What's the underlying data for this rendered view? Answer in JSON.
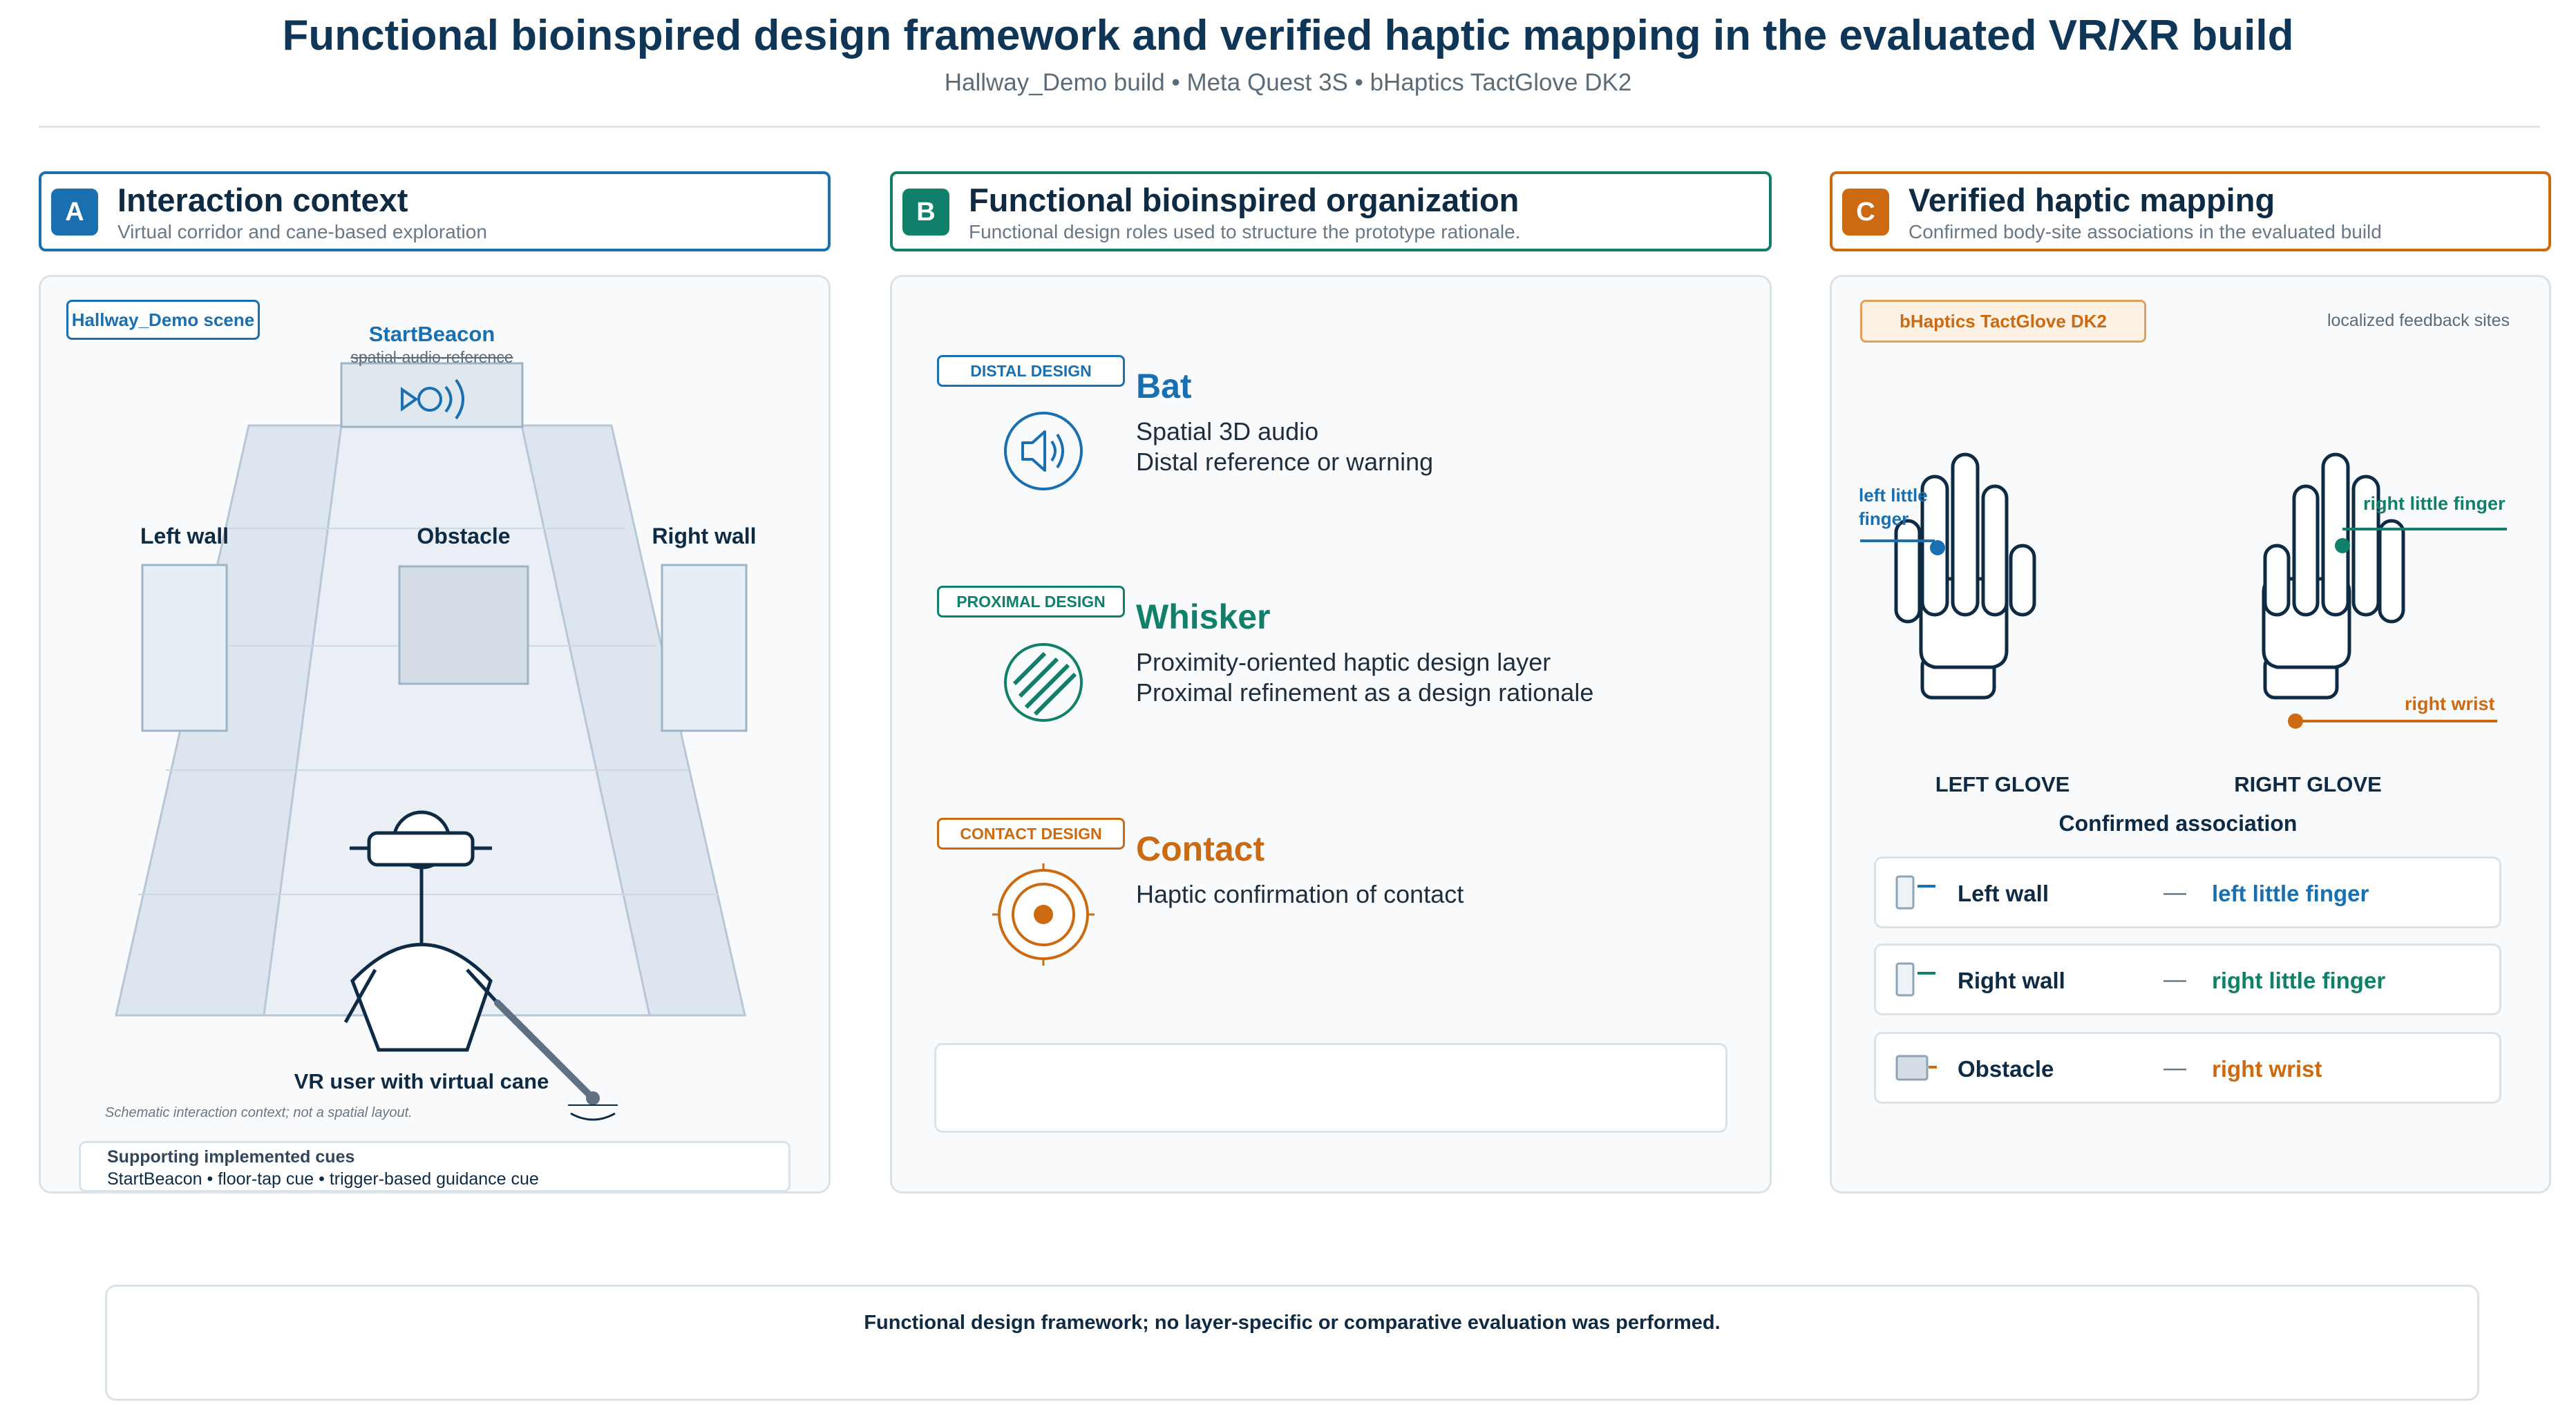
{
  "header": {
    "title": "Functional bioinspired design framework and verified haptic mapping in the evaluated VR/XR build",
    "subtitle": "Hallway_Demo build • Meta Quest 3S • bHaptics TactGlove DK2"
  },
  "colors": {
    "blue": "#1a6fb0",
    "teal": "#11806a",
    "orange": "#cc6a12",
    "navy": "#0f2b44"
  },
  "sections": {
    "a": {
      "badge": "A",
      "title": "Interaction context",
      "subtitle": "Virtual corridor and cane-based exploration",
      "scene_tag": "Hallway_Demo scene",
      "beacon_label": "StartBeacon",
      "beacon_sub": "spatial-audio-reference",
      "left_wall": "Left wall",
      "obstacle": "Obstacle",
      "right_wall": "Right wall",
      "user_label": "VR user with virtual cane",
      "note": "Schematic interaction context; not a spatial layout.",
      "cues_title": "Supporting implemented cues",
      "cues_text": "StartBeacon • floor-tap cue • trigger-based guidance cue"
    },
    "b": {
      "badge": "B",
      "title": "Functional bioinspired organization",
      "subtitle": "Functional design roles used to structure the prototype rationale.",
      "layers": [
        {
          "tag": "DISTAL DESIGN",
          "title": "Bat",
          "line1": "Spatial 3D audio",
          "line2": "Distal reference or warning",
          "icon": "speaker-icon"
        },
        {
          "tag": "PROXIMAL DESIGN",
          "title": "Whisker",
          "line1": "Proximity-oriented haptic design layer",
          "line2": "Proximal refinement as a design rationale",
          "icon": "hatch-circle-icon"
        },
        {
          "tag": "CONTACT DESIGN",
          "title": "Contact",
          "line1": "Haptic confirmation of contact",
          "line2": "",
          "icon": "target-icon"
        }
      ]
    },
    "c": {
      "badge": "C",
      "title": "Verified haptic mapping",
      "subtitle": "Confirmed body-site associations in the evaluated build",
      "device_tag": "bHaptics TactGlove DK2",
      "sites_note": "localized feedback sites",
      "left_little": [
        "left little",
        "finger"
      ],
      "right_little": "right little finger",
      "right_wrist": "right wrist",
      "left_glove": "LEFT GLOVE",
      "right_glove": "RIGHT GLOVE",
      "assoc_title": "Confirmed association",
      "rows": [
        {
          "source": "Left wall",
          "dash": "—",
          "target": "left little finger"
        },
        {
          "source": "Right wall",
          "dash": "—",
          "target": "right little finger"
        },
        {
          "source": "Obstacle",
          "dash": "—",
          "target": "right wrist"
        }
      ]
    }
  },
  "footer": {
    "text": "Functional design framework; no layer-specific or comparative evaluation was performed."
  }
}
